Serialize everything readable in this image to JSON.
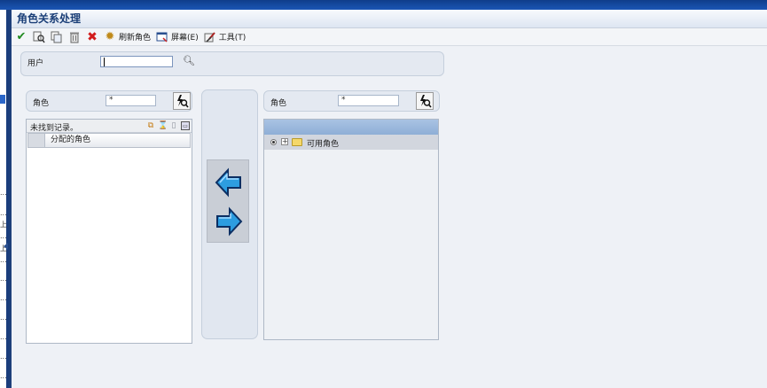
{
  "window": {
    "title": "角色关系处理"
  },
  "toolbar": {
    "buttons": [
      {
        "icon": "check-icon",
        "label": ""
      },
      {
        "icon": "search-doc-icon",
        "label": ""
      },
      {
        "icon": "copy-icon",
        "label": ""
      },
      {
        "icon": "delete-icon",
        "label": ""
      },
      {
        "icon": "close-x-icon",
        "label": ""
      }
    ],
    "refresh_label": "刷新角色",
    "screen_label": "屏幕(E)",
    "tools_label": "工具(T)"
  },
  "user_filter": {
    "label": "用户",
    "value": ""
  },
  "assigned_roles": {
    "role_label": "角色",
    "role_value": "*",
    "grid_message": "未找到记录。",
    "column_header": "分配的角色",
    "rows": []
  },
  "available_roles": {
    "role_label": "角色",
    "role_value": "*",
    "tree_items": [
      {
        "label": "可用角色",
        "expander": "+"
      }
    ]
  },
  "left_strip": {
    "marks": [
      "...",
      "...",
      "上",
      "...",
      "上",
      "...",
      "...",
      "...",
      "...",
      "...",
      "...",
      "..."
    ]
  },
  "colors": {
    "accent": "#1b3f78",
    "arrow": "#2d9de0",
    "tree_header": "#9bb7dd"
  }
}
